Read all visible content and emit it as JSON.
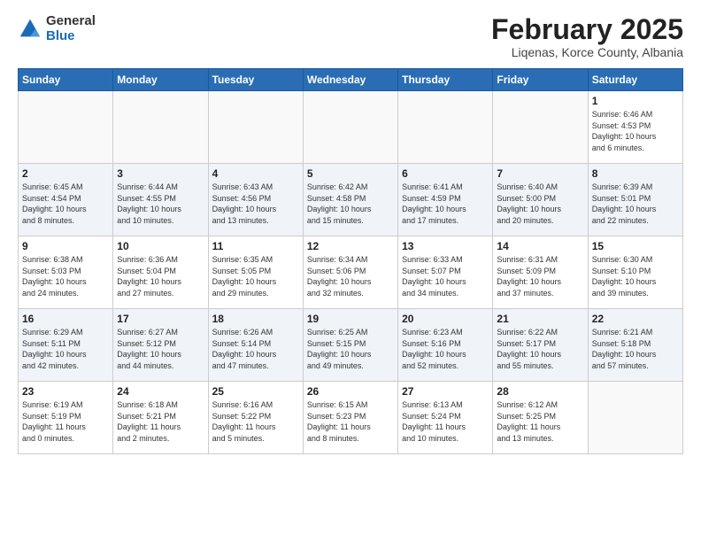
{
  "header": {
    "logo_general": "General",
    "logo_blue": "Blue",
    "month_title": "February 2025",
    "location": "Liqenas, Korce County, Albania"
  },
  "weekdays": [
    "Sunday",
    "Monday",
    "Tuesday",
    "Wednesday",
    "Thursday",
    "Friday",
    "Saturday"
  ],
  "weeks": [
    [
      {
        "day": "",
        "info": ""
      },
      {
        "day": "",
        "info": ""
      },
      {
        "day": "",
        "info": ""
      },
      {
        "day": "",
        "info": ""
      },
      {
        "day": "",
        "info": ""
      },
      {
        "day": "",
        "info": ""
      },
      {
        "day": "1",
        "info": "Sunrise: 6:46 AM\nSunset: 4:53 PM\nDaylight: 10 hours\nand 6 minutes."
      }
    ],
    [
      {
        "day": "2",
        "info": "Sunrise: 6:45 AM\nSunset: 4:54 PM\nDaylight: 10 hours\nand 8 minutes."
      },
      {
        "day": "3",
        "info": "Sunrise: 6:44 AM\nSunset: 4:55 PM\nDaylight: 10 hours\nand 10 minutes."
      },
      {
        "day": "4",
        "info": "Sunrise: 6:43 AM\nSunset: 4:56 PM\nDaylight: 10 hours\nand 13 minutes."
      },
      {
        "day": "5",
        "info": "Sunrise: 6:42 AM\nSunset: 4:58 PM\nDaylight: 10 hours\nand 15 minutes."
      },
      {
        "day": "6",
        "info": "Sunrise: 6:41 AM\nSunset: 4:59 PM\nDaylight: 10 hours\nand 17 minutes."
      },
      {
        "day": "7",
        "info": "Sunrise: 6:40 AM\nSunset: 5:00 PM\nDaylight: 10 hours\nand 20 minutes."
      },
      {
        "day": "8",
        "info": "Sunrise: 6:39 AM\nSunset: 5:01 PM\nDaylight: 10 hours\nand 22 minutes."
      }
    ],
    [
      {
        "day": "9",
        "info": "Sunrise: 6:38 AM\nSunset: 5:03 PM\nDaylight: 10 hours\nand 24 minutes."
      },
      {
        "day": "10",
        "info": "Sunrise: 6:36 AM\nSunset: 5:04 PM\nDaylight: 10 hours\nand 27 minutes."
      },
      {
        "day": "11",
        "info": "Sunrise: 6:35 AM\nSunset: 5:05 PM\nDaylight: 10 hours\nand 29 minutes."
      },
      {
        "day": "12",
        "info": "Sunrise: 6:34 AM\nSunset: 5:06 PM\nDaylight: 10 hours\nand 32 minutes."
      },
      {
        "day": "13",
        "info": "Sunrise: 6:33 AM\nSunset: 5:07 PM\nDaylight: 10 hours\nand 34 minutes."
      },
      {
        "day": "14",
        "info": "Sunrise: 6:31 AM\nSunset: 5:09 PM\nDaylight: 10 hours\nand 37 minutes."
      },
      {
        "day": "15",
        "info": "Sunrise: 6:30 AM\nSunset: 5:10 PM\nDaylight: 10 hours\nand 39 minutes."
      }
    ],
    [
      {
        "day": "16",
        "info": "Sunrise: 6:29 AM\nSunset: 5:11 PM\nDaylight: 10 hours\nand 42 minutes."
      },
      {
        "day": "17",
        "info": "Sunrise: 6:27 AM\nSunset: 5:12 PM\nDaylight: 10 hours\nand 44 minutes."
      },
      {
        "day": "18",
        "info": "Sunrise: 6:26 AM\nSunset: 5:14 PM\nDaylight: 10 hours\nand 47 minutes."
      },
      {
        "day": "19",
        "info": "Sunrise: 6:25 AM\nSunset: 5:15 PM\nDaylight: 10 hours\nand 49 minutes."
      },
      {
        "day": "20",
        "info": "Sunrise: 6:23 AM\nSunset: 5:16 PM\nDaylight: 10 hours\nand 52 minutes."
      },
      {
        "day": "21",
        "info": "Sunrise: 6:22 AM\nSunset: 5:17 PM\nDaylight: 10 hours\nand 55 minutes."
      },
      {
        "day": "22",
        "info": "Sunrise: 6:21 AM\nSunset: 5:18 PM\nDaylight: 10 hours\nand 57 minutes."
      }
    ],
    [
      {
        "day": "23",
        "info": "Sunrise: 6:19 AM\nSunset: 5:19 PM\nDaylight: 11 hours\nand 0 minutes."
      },
      {
        "day": "24",
        "info": "Sunrise: 6:18 AM\nSunset: 5:21 PM\nDaylight: 11 hours\nand 2 minutes."
      },
      {
        "day": "25",
        "info": "Sunrise: 6:16 AM\nSunset: 5:22 PM\nDaylight: 11 hours\nand 5 minutes."
      },
      {
        "day": "26",
        "info": "Sunrise: 6:15 AM\nSunset: 5:23 PM\nDaylight: 11 hours\nand 8 minutes."
      },
      {
        "day": "27",
        "info": "Sunrise: 6:13 AM\nSunset: 5:24 PM\nDaylight: 11 hours\nand 10 minutes."
      },
      {
        "day": "28",
        "info": "Sunrise: 6:12 AM\nSunset: 5:25 PM\nDaylight: 11 hours\nand 13 minutes."
      },
      {
        "day": "",
        "info": ""
      }
    ]
  ]
}
